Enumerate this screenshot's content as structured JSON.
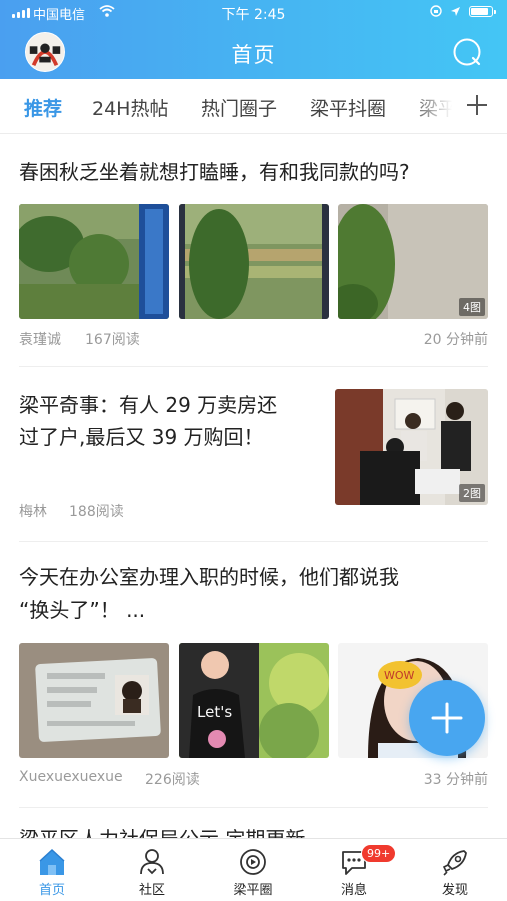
{
  "status": {
    "carrier": "中国电信",
    "time": "下午 2:45"
  },
  "header": {
    "title": "首页",
    "brand_color": "#46b5f2"
  },
  "tabs": [
    {
      "label": "推荐",
      "active": true
    },
    {
      "label": "24H热帖"
    },
    {
      "label": "热门圈子"
    },
    {
      "label": "梁平抖圈"
    },
    {
      "label": "梁平"
    }
  ],
  "posts": [
    {
      "title": "春困秋乏坐着就想打瞌睡，有和我同款的吗?",
      "author": "袁瑾诚",
      "reads": "167阅读",
      "time": "20 分钟前",
      "image_count": "4图"
    },
    {
      "title_line1": "梁平奇事：有人 29 万卖房还",
      "title_line2": "过了户,最后又 39 万购回！",
      "author": "梅林",
      "reads": "188阅读",
      "image_count": "2图"
    },
    {
      "title_line1": "今天在办公室办理入职的时候，他们都说我",
      "title_line2": "“换头了”！ ...",
      "author": "Xuexuexuexue",
      "reads": "226阅读",
      "time": "33 分钟前"
    },
    {
      "title": "梁平区人力社保局公示  定期更新"
    }
  ],
  "bottom_nav": [
    {
      "label": "首页",
      "active": true,
      "icon": "home-icon"
    },
    {
      "label": "社区",
      "icon": "community-icon"
    },
    {
      "label": "梁平圈",
      "icon": "circle-icon"
    },
    {
      "label": "消息",
      "icon": "message-icon",
      "badge": "99+"
    },
    {
      "label": "发现",
      "icon": "rocket-icon"
    }
  ],
  "accent_color": "#3a97e6",
  "badge_color": "#f03a2e"
}
